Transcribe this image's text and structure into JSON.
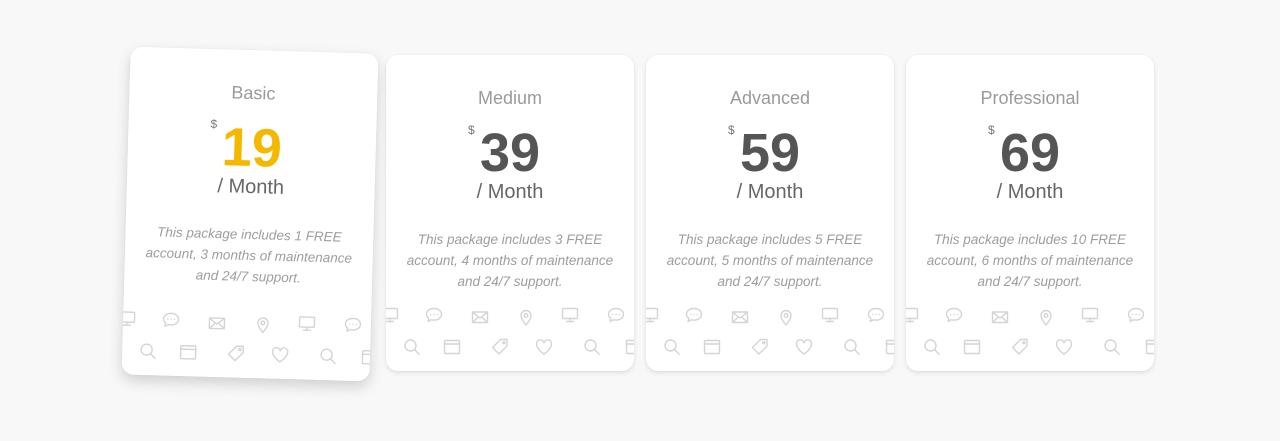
{
  "plans": [
    {
      "name": "Basic",
      "currency": "$",
      "price": "19",
      "period": "/ Month",
      "description": "This package includes 1 FREE account, 3 months of maintenance and 24/7 support.",
      "featured": true
    },
    {
      "name": "Medium",
      "currency": "$",
      "price": "39",
      "period": "/ Month",
      "description": "This package includes 3 FREE account, 4 months of maintenance and 24/7 support.",
      "featured": false
    },
    {
      "name": "Advanced",
      "currency": "$",
      "price": "59",
      "period": "/ Month",
      "description": "This package includes 5 FREE account, 5 months of maintenance and 24/7 support.",
      "featured": false
    },
    {
      "name": "Professional",
      "currency": "$",
      "price": "69",
      "period": "/ Month",
      "description": "This package includes 10 FREE account, 6 months of maintenance and 24/7 support.",
      "featured": false
    }
  ],
  "icon_pattern": [
    "monitor-icon",
    "chat-icon",
    "mail-icon",
    "location-pin-icon",
    "monitor-icon",
    "chat-icon",
    "search-icon",
    "browser-window-icon",
    "tag-icon",
    "heart-icon",
    "search-icon",
    "browser-window-icon"
  ],
  "colors": {
    "featured_price": "#f5b800",
    "price": "#555555",
    "background": "#f8f8f8",
    "card": "#ffffff"
  }
}
